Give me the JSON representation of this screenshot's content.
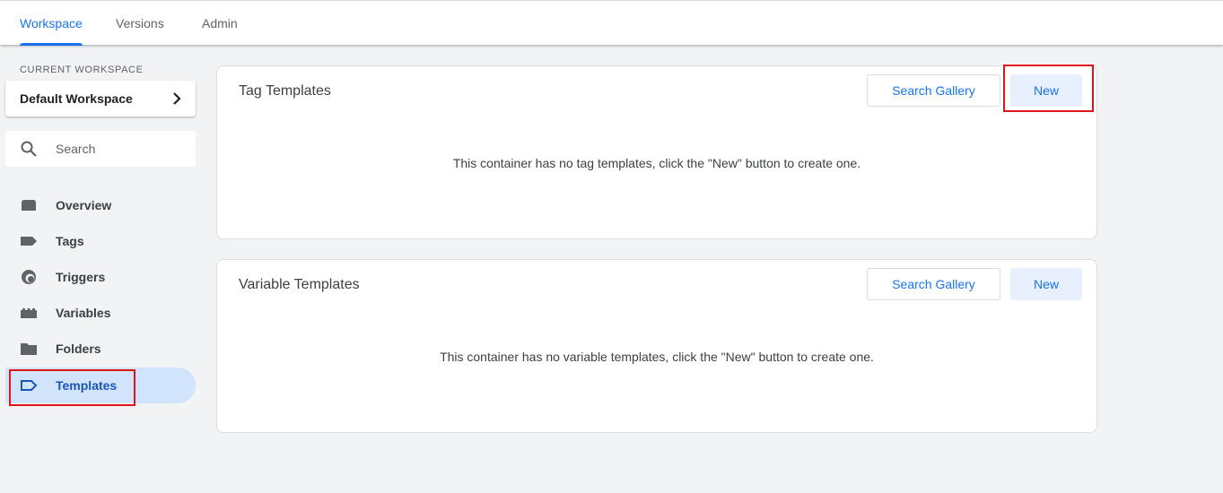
{
  "tabs": [
    {
      "label": "Workspace",
      "active": true
    },
    {
      "label": "Versions",
      "active": false
    },
    {
      "label": "Admin",
      "active": false
    }
  ],
  "sidebar": {
    "workspace_label": "CURRENT WORKSPACE",
    "workspace_name": "Default Workspace",
    "search_placeholder": "Search",
    "items": [
      {
        "label": "Overview",
        "icon": "overview-icon"
      },
      {
        "label": "Tags",
        "icon": "tag-icon"
      },
      {
        "label": "Triggers",
        "icon": "trigger-icon"
      },
      {
        "label": "Variables",
        "icon": "variables-icon"
      },
      {
        "label": "Folders",
        "icon": "folder-icon"
      },
      {
        "label": "Templates",
        "icon": "template-icon",
        "selected": true
      }
    ]
  },
  "cards": {
    "tag_templates": {
      "title": "Tag Templates",
      "gallery_label": "Search Gallery",
      "new_label": "New",
      "empty_message": "This container has no tag templates, click the \"New\" button to create one."
    },
    "variable_templates": {
      "title": "Variable Templates",
      "gallery_label": "Search Gallery",
      "new_label": "New",
      "empty_message": "This container has no variable templates, click the \"New\" button to create one."
    }
  },
  "colors": {
    "accent": "#1a73e8",
    "selected_bg": "#d2e3fc",
    "highlight": "#e0151b"
  }
}
